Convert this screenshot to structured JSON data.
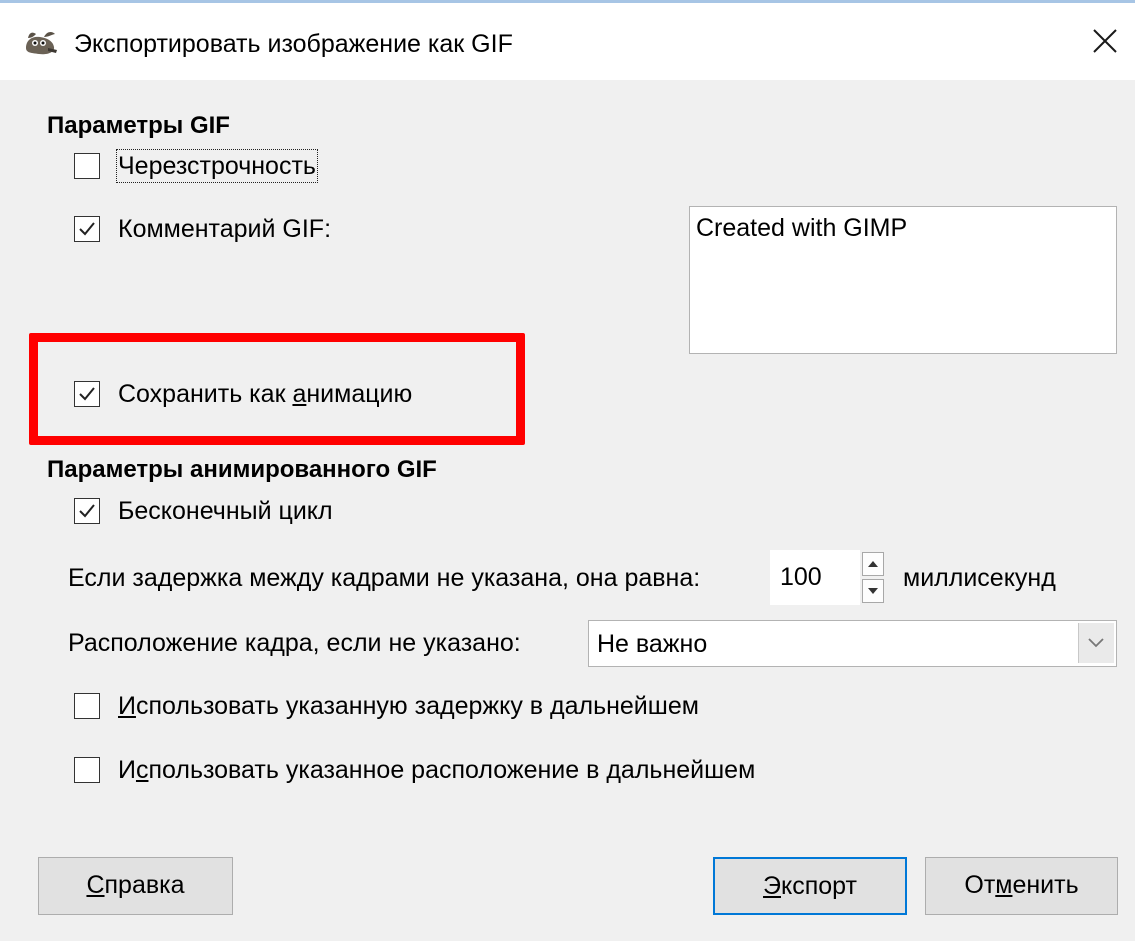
{
  "window": {
    "title": "Экспортировать изображение как GIF"
  },
  "gif_params": {
    "heading": "Параметры GIF",
    "interlace": {
      "label": "Черезстрочность",
      "checked": false
    },
    "comment": {
      "label": "Комментарий GIF:",
      "checked": true,
      "text": "Created with GIMP"
    },
    "save_as_animation": {
      "label_pre": "Сохранить как ",
      "label_key": "а",
      "label_post": "нимацию",
      "checked": true
    }
  },
  "anim_params": {
    "heading": "Параметры анимированного GIF",
    "loop": {
      "label": "Бесконечный цикл",
      "checked": true
    },
    "delay": {
      "label": "Если задержка между кадрами не указана, она равна:",
      "value": "100",
      "unit": "миллисекунд"
    },
    "disposal": {
      "label": "Расположение кадра, если не указано:",
      "value": "Не важно"
    },
    "use_delay": {
      "label_key": "И",
      "label_post": "спользовать указанную задержку в дальнейшем",
      "checked": false
    },
    "use_disposal": {
      "label_pre": "И",
      "label_key": "с",
      "label_post": "пользовать указанное расположение в дальнейшем",
      "checked": false
    }
  },
  "buttons": {
    "help": {
      "key": "С",
      "rest": "правка"
    },
    "export": {
      "key": "Э",
      "rest": "кспорт"
    },
    "cancel": {
      "pre": "От",
      "key": "м",
      "rest": "енить"
    }
  },
  "colors": {
    "highlight_box": "#ff0000",
    "default_button_border": "#0078d7",
    "dialog_background": "#f0f0f0"
  },
  "icons": {
    "app": "gimp-wilber-icon",
    "close": "close-icon",
    "checkmark": "checkmark-icon",
    "spin_up": "arrow-up-icon",
    "spin_down": "arrow-down-icon",
    "combo": "chevron-down-icon"
  }
}
